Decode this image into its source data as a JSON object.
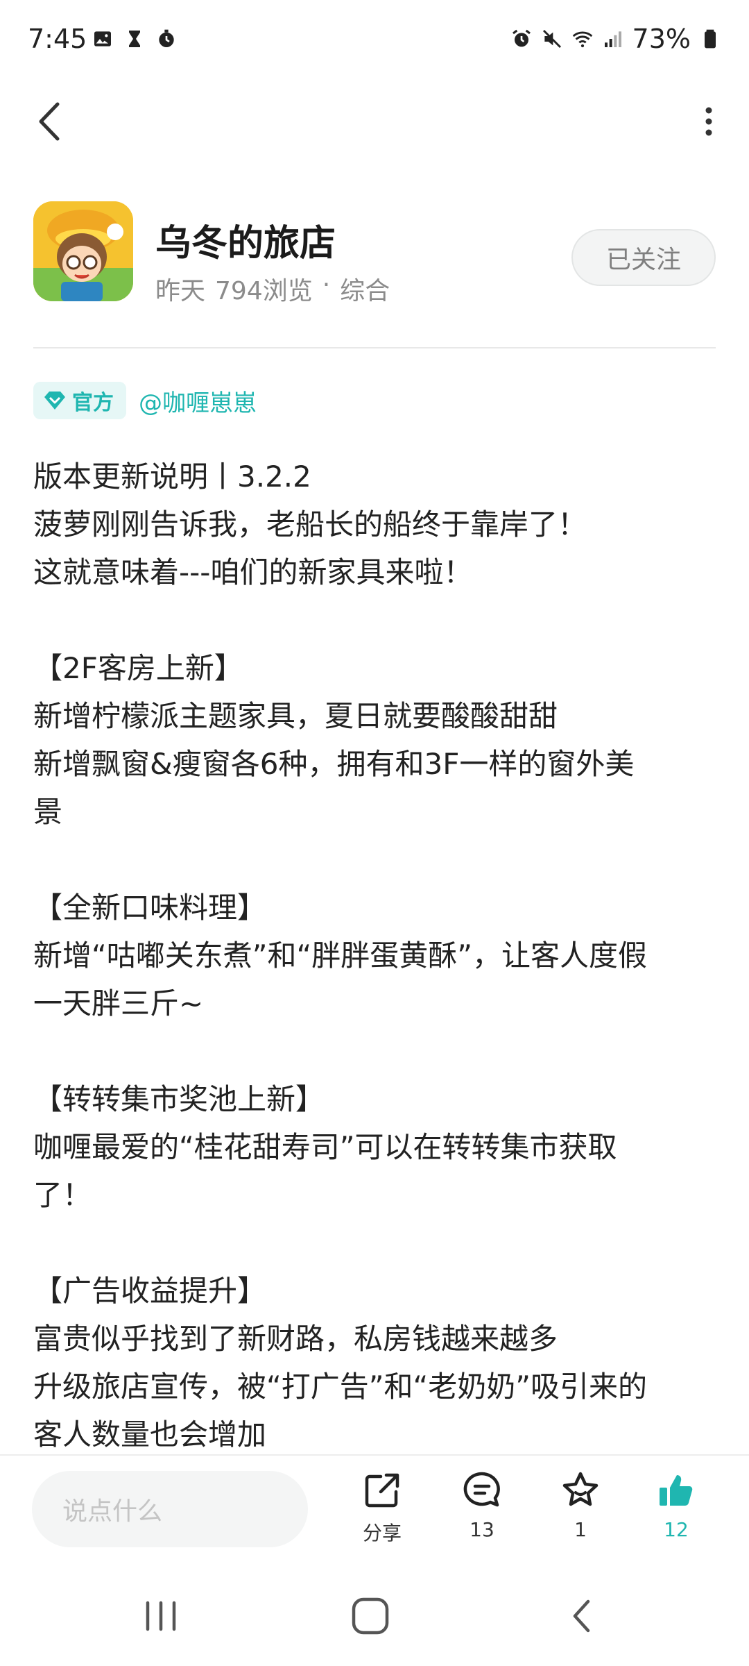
{
  "status_bar": {
    "time": "7:45",
    "battery": "73%"
  },
  "app": {
    "name": "乌冬的旅店",
    "time_label": "昨天",
    "views": "794浏览",
    "separator": "·",
    "category": "综合",
    "follow_label": "已关注"
  },
  "author": {
    "badge": "官方",
    "name": "@咖喱崽崽"
  },
  "post": {
    "lines": [
      "版本更新说明丨3.2.2",
      "菠萝刚刚告诉我，老船长的船终于靠岸了！",
      "这就意味着---咱们的新家具来啦！",
      "",
      "【2F客房上新】",
      "新增柠檬派主题家具，夏日就要酸酸甜甜",
      "新增飘窗&瘦窗各6种，拥有和3F一样的窗外美",
      "景",
      "",
      "【全新口味料理】",
      "新增“咕嘟关东煮”和“胖胖蛋黄酥”，让客人度假",
      "一天胖三斤~",
      "",
      "【转转集市奖池上新】",
      "咖喱最爱的“桂花甜寿司”可以在转转集市获取",
      "了！",
      "",
      "【广告收益提升】",
      "富贵似乎找到了新财路，私房钱越来越多",
      "升级旅店宣传，被“打广告”和“老奶奶”吸引来的",
      "客人数量也会增加"
    ]
  },
  "bottom_bar": {
    "comment_placeholder": "说点什么",
    "share_label": "分享",
    "comment_count": "13",
    "favorite_count": "1",
    "like_count": "12"
  },
  "colors": {
    "accent": "#1fb6b0",
    "text": "#222222",
    "muted": "#8b8b8b"
  },
  "icons": [
    "gallery-icon",
    "hourglass-icon",
    "timer-icon",
    "alarm-icon",
    "mute-icon",
    "wifi-icon",
    "signal-icon",
    "battery-icon",
    "back-arrow-icon",
    "more-vertical-icon",
    "share-icon",
    "comment-icon",
    "star-icon",
    "thumbs-up-icon",
    "recent-apps-icon",
    "home-icon",
    "nav-back-icon"
  ]
}
